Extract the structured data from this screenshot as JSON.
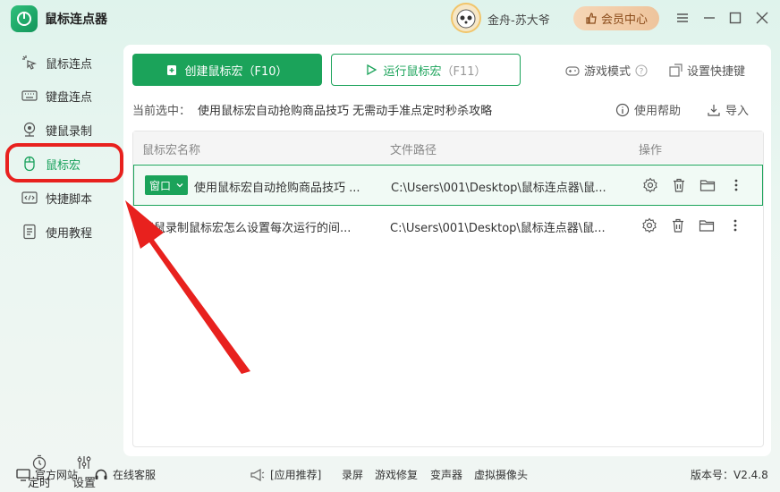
{
  "app": {
    "title": "鼠标连点器",
    "username": "金舟-苏大爷",
    "vip_label": "会员中心",
    "accent": "#1ba35a"
  },
  "sidebar": {
    "items": [
      {
        "label": "鼠标连点",
        "icon": "cursor-click-icon"
      },
      {
        "label": "键盘连点",
        "icon": "keyboard-icon"
      },
      {
        "label": "键鼠录制",
        "icon": "record-icon"
      },
      {
        "label": "鼠标宏",
        "icon": "mouse-icon"
      },
      {
        "label": "快捷脚本",
        "icon": "code-icon"
      },
      {
        "label": "使用教程",
        "icon": "tutorial-icon"
      }
    ],
    "active": "鼠标宏",
    "timer_label": "定时",
    "settings_label": "设置"
  },
  "toolbar": {
    "create_label": "创建鼠标宏",
    "create_key": "（F10）",
    "run_label": "运行鼠标宏",
    "run_key": "（F11）",
    "game_mode_label": "游戏模式",
    "hotkey_label": "设置快捷键",
    "help_label": "使用帮助",
    "import_label": "导入"
  },
  "current": {
    "label": "当前选中：",
    "value": "使用鼠标宏自动抢购商品技巧 无需动手准点定时秒杀攻略"
  },
  "table": {
    "headers": [
      "鼠标宏名称",
      "文件路径",
      "操作"
    ],
    "rows": [
      {
        "tag": "窗口",
        "name": "使用鼠标宏自动抢购商品技巧 ...",
        "path": "C:\\Users\\001\\Desktop\\鼠标连点器\\鼠...",
        "selected": true
      },
      {
        "tag": "",
        "name": "键鼠录制鼠标宏怎么设置每次运行的间...",
        "path": "C:\\Users\\001\\Desktop\\鼠标连点器\\鼠...",
        "selected": false
      }
    ]
  },
  "footer": {
    "website": "官方网站",
    "service": "在线客服",
    "recommend": "[应用推荐]",
    "links": [
      "录屏",
      "游戏修复",
      "变声器",
      "虚拟摄像头"
    ],
    "version": "版本号：V2.4.8"
  }
}
